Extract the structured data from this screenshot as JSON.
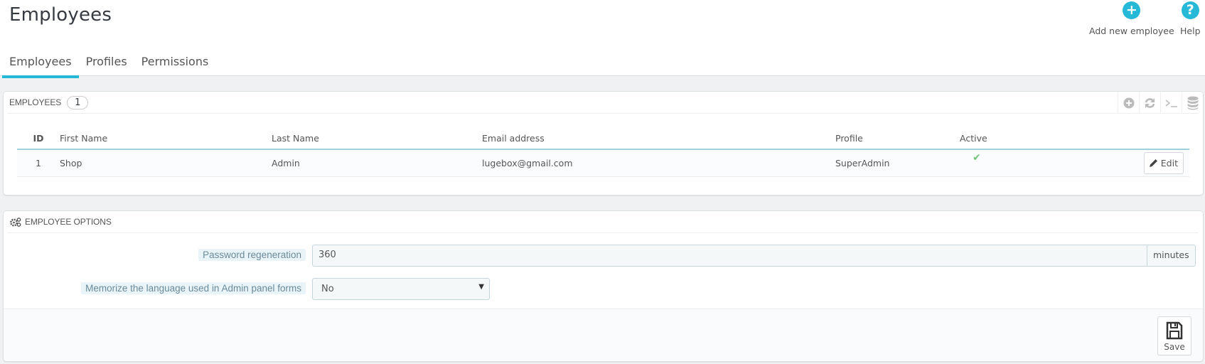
{
  "header": {
    "title": "Employees",
    "toolbar": [
      {
        "label": "Add new employee",
        "icon": "plus-circle-icon"
      },
      {
        "label": "Help",
        "icon": "question-circle-icon"
      }
    ]
  },
  "tabs": [
    {
      "label": "Employees",
      "active": true
    },
    {
      "label": "Profiles",
      "active": false
    },
    {
      "label": "Permissions",
      "active": false
    }
  ],
  "employees_panel": {
    "title": "Employees",
    "count": "1",
    "tools": [
      {
        "icon": "add-circle-icon"
      },
      {
        "icon": "refresh-icon"
      },
      {
        "icon": "sql-terminal-icon"
      },
      {
        "icon": "database-icon"
      }
    ],
    "columns": [
      "ID",
      "First Name",
      "Last Name",
      "Email address",
      "Profile",
      "Active"
    ],
    "rows": [
      {
        "id": "1",
        "first_name": "Shop",
        "last_name": "Admin",
        "email": "lugebox@gmail.com",
        "profile": "SuperAdmin",
        "active": true,
        "active_glyph": "✔",
        "edit_label": "Edit"
      }
    ]
  },
  "options_panel": {
    "title": "Employee options",
    "password_regeneration": {
      "label": "Password regeneration",
      "value": "360",
      "suffix": "minutes"
    },
    "memorize_language": {
      "label": "Memorize the language used in Admin panel forms",
      "value": "No"
    },
    "save_label": "Save"
  },
  "colors": {
    "accent": "#25b9d7",
    "active_check": "#72c279"
  }
}
